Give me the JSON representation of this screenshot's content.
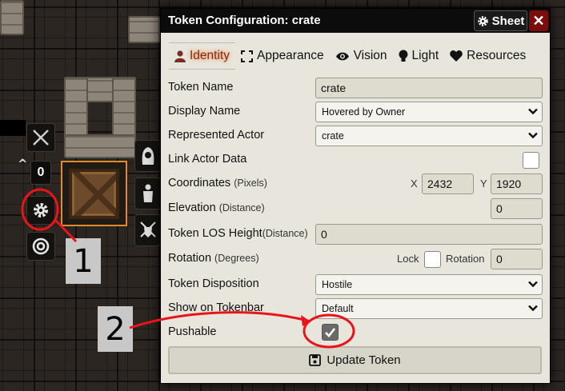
{
  "dialog": {
    "title": "Token Configuration: crate",
    "sheet_label": "Sheet",
    "close_label": "✕"
  },
  "tabs": [
    {
      "label": "Identity",
      "icon": "user-icon",
      "active": true
    },
    {
      "label": "Appearance",
      "icon": "frame-icon",
      "active": false
    },
    {
      "label": "Vision",
      "icon": "eye-icon",
      "active": false
    },
    {
      "label": "Light",
      "icon": "lightbulb-icon",
      "active": false
    },
    {
      "label": "Resources",
      "icon": "heart-icon",
      "active": false
    }
  ],
  "form": {
    "token_name": {
      "label": "Token Name",
      "value": "crate"
    },
    "display_name": {
      "label": "Display Name",
      "value": "Hovered by Owner"
    },
    "represented_actor": {
      "label": "Represented Actor",
      "value": "crate"
    },
    "link_actor": {
      "label": "Link Actor Data",
      "checked": false
    },
    "coordinates": {
      "label": "Coordinates",
      "unit": "(Pixels)",
      "x_label": "X",
      "x": "2432",
      "y_label": "Y",
      "y": "1920"
    },
    "elevation": {
      "label": "Elevation",
      "unit": "(Distance)",
      "value": "0"
    },
    "los_height": {
      "label": "Token LOS Height",
      "unit": "(Distance)",
      "value": "0"
    },
    "rotation": {
      "label": "Rotation",
      "unit": "(Degrees)",
      "lock_label": "Lock",
      "lock_checked": false,
      "rot_label": "Rotation",
      "value": "0"
    },
    "disposition": {
      "label": "Token Disposition",
      "value": "Hostile"
    },
    "tokenbar": {
      "label": "Show on Tokenbar",
      "value": "Default"
    },
    "pushable": {
      "label": "Pushable",
      "checked": true
    }
  },
  "update_label": "Update Token",
  "hud": {
    "elevation": "0",
    "elevation_arrow": "^"
  },
  "annotations": {
    "label1": "1",
    "label2": "2",
    "color": "#e8141a"
  },
  "colors": {
    "accent": "#782e22",
    "token_border": "#e38a2b",
    "close_bg": "#7a0d0d"
  }
}
